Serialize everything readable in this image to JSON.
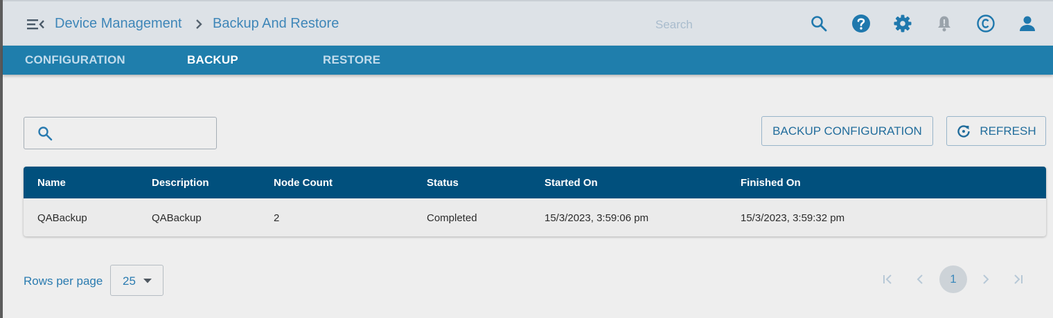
{
  "header": {
    "breadcrumb": [
      "Device Management",
      "Backup And Restore"
    ],
    "search_placeholder": "Search",
    "icons": [
      "menu-collapse-icon",
      "search-icon",
      "help-icon",
      "gear-icon",
      "bell-icon",
      "copyright-icon",
      "user-icon"
    ]
  },
  "tabs": [
    {
      "label": "CONFIGURATION",
      "active": false
    },
    {
      "label": "BACKUP",
      "active": true
    },
    {
      "label": "RESTORE",
      "active": false
    }
  ],
  "toolbar": {
    "filter_value": "",
    "backup_label": "BACKUP CONFIGURATION",
    "refresh_label": "REFRESH"
  },
  "table": {
    "columns": [
      "Name",
      "Description",
      "Node Count",
      "Status",
      "Started On",
      "Finished On"
    ],
    "rows": [
      [
        "QABackup",
        "QABackup",
        "2",
        "Completed",
        "15/3/2023, 3:59:06 pm",
        "15/3/2023, 3:59:32 pm"
      ]
    ]
  },
  "pagination": {
    "rows_per_page_label": "Rows per page",
    "rows_per_page_value": "25",
    "current_page": "1"
  },
  "colors": {
    "accent": "#1f7eac",
    "table_header": "#01507d",
    "link_text": "#3e86b8"
  }
}
